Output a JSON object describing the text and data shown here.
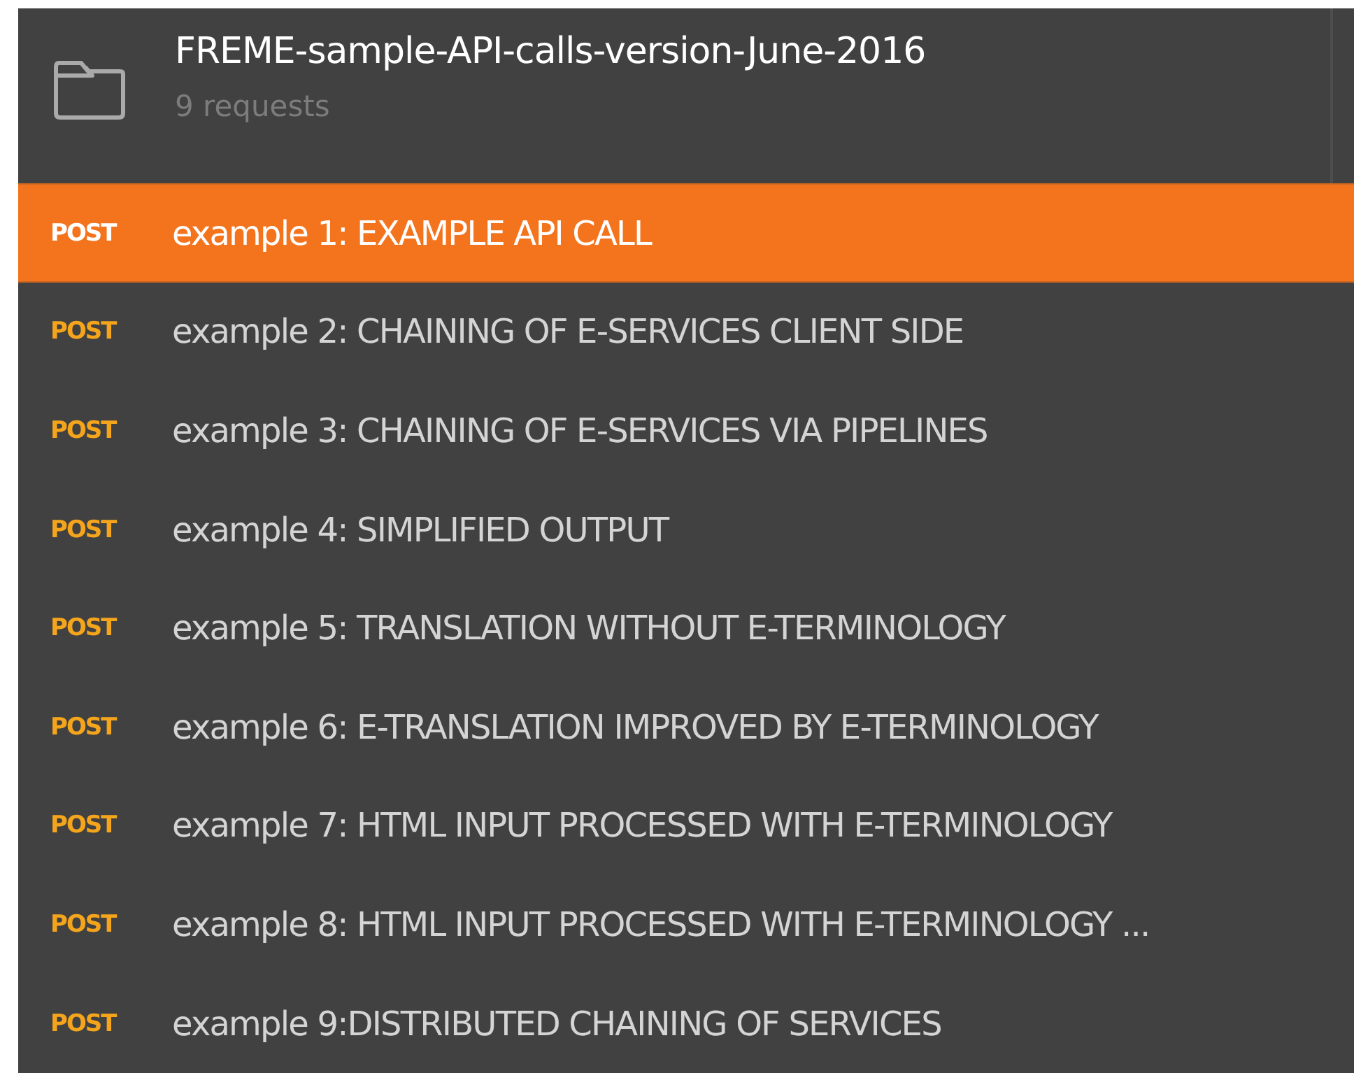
{
  "collection": {
    "name": "FREME-sample-API-calls-version-June-2016",
    "count": "9 requests"
  },
  "requests": [
    {
      "method": "POST",
      "name": "example 1: EXAMPLE API CALL",
      "selected": true
    },
    {
      "method": "POST",
      "name": "example 2: CHAINING OF E-SERVICES CLIENT SIDE",
      "selected": false
    },
    {
      "method": "POST",
      "name": "example 3: CHAINING OF E-SERVICES VIA PIPELINES",
      "selected": false
    },
    {
      "method": "POST",
      "name": "example 4: SIMPLIFIED OUTPUT",
      "selected": false
    },
    {
      "method": "POST",
      "name": "example 5: TRANSLATION WITHOUT E-TERMINOLOGY",
      "selected": false
    },
    {
      "method": "POST",
      "name": "example 6: E-TRANSLATION IMPROVED BY E-TERMINOLOGY",
      "selected": false
    },
    {
      "method": "POST",
      "name": "example 7: HTML INPUT PROCESSED WITH E-TERMINOLOGY",
      "selected": false
    },
    {
      "method": "POST",
      "name": "example 8: HTML INPUT PROCESSED WITH E-TERMINOLOGY ...",
      "selected": false
    },
    {
      "method": "POST",
      "name": "example 9:DISTRIBUTED CHAINING OF SERVICES",
      "selected": false
    }
  ]
}
